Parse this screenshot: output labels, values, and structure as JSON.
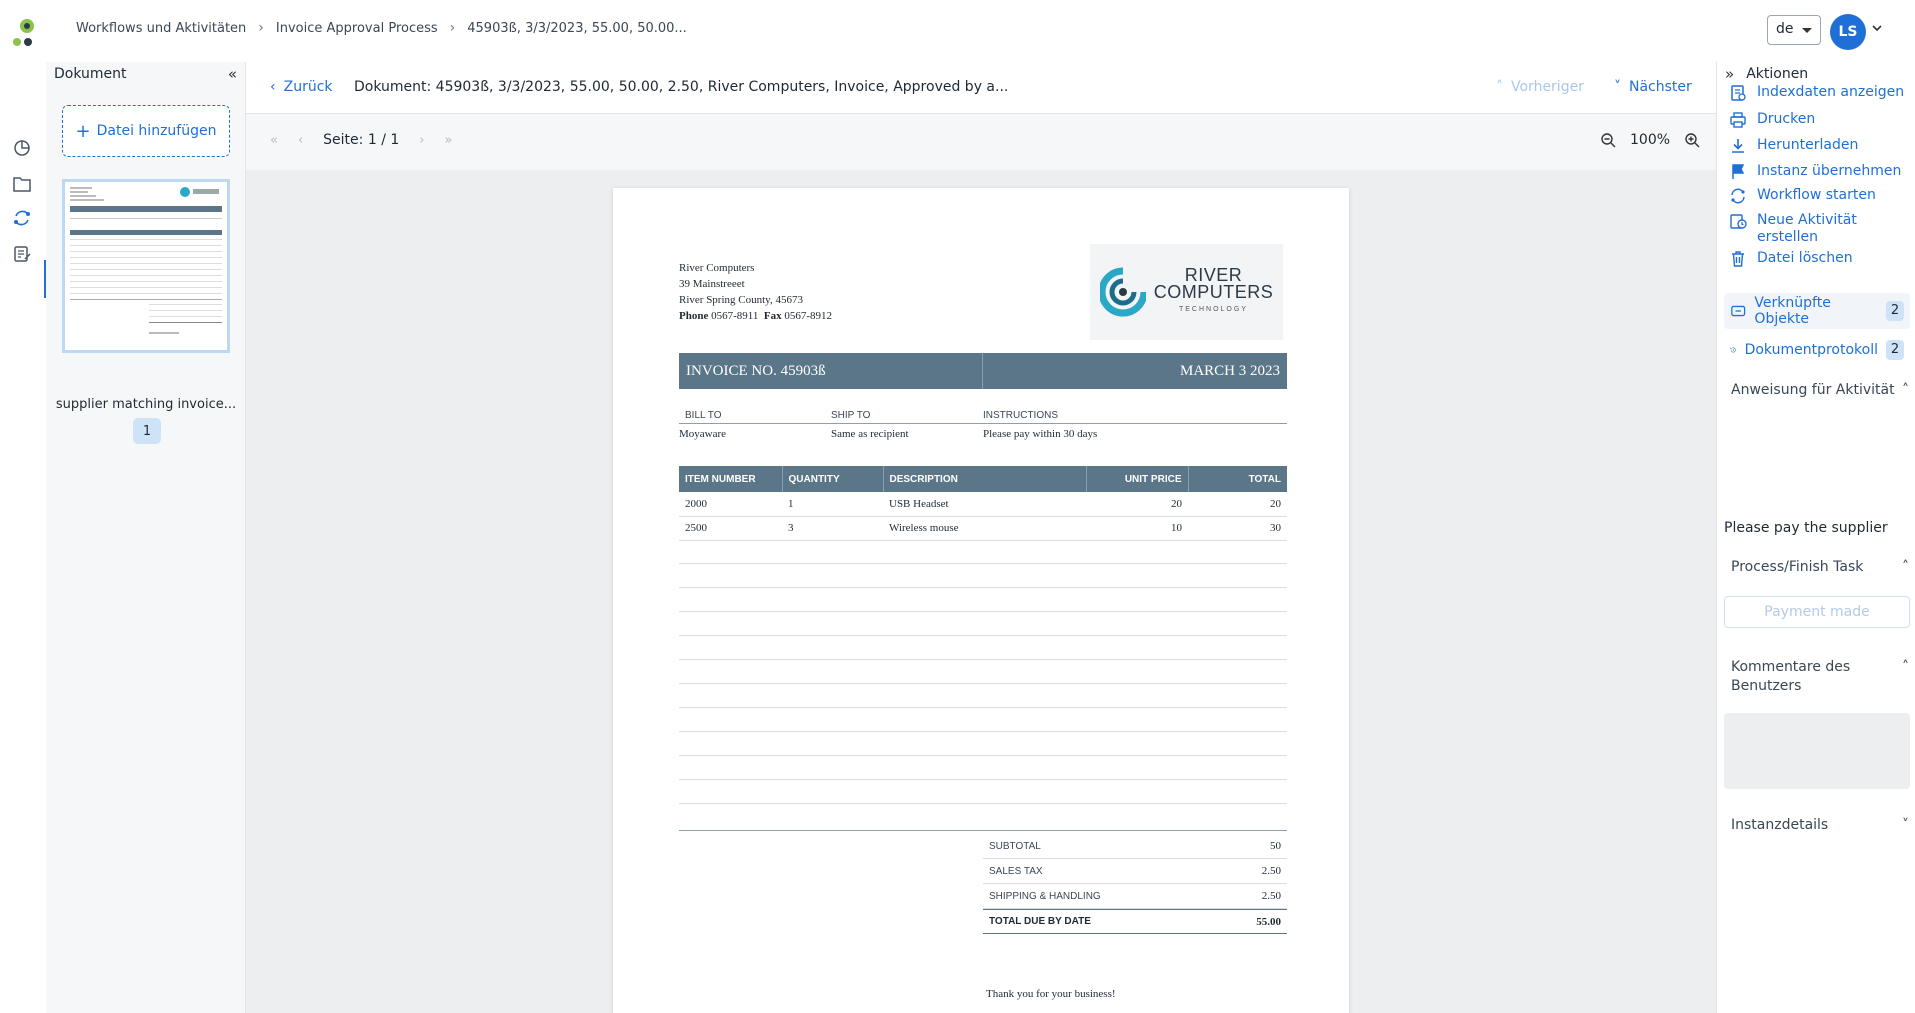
{
  "breadcrumb": [
    "Workflows und Aktivitäten",
    "Invoice Approval Process",
    "45903ß, 3/3/2023, 55.00, 50.00..."
  ],
  "lang": "de",
  "user_initials": "LS",
  "doc_panel": {
    "title": "Dokument",
    "add_file": "Datei hinzufügen",
    "file_label": "supplier matching invoice...",
    "page_badge": "1"
  },
  "viewer": {
    "back": "Zurück",
    "title": "Dokument: 45903ß, 3/3/2023, 55.00, 50.00, 2.50, River Computers, Invoice, Approved by a...",
    "prev": "Vorheriger",
    "next": "Nächster",
    "page_info": "Seite: 1 / 1",
    "zoom": "100%"
  },
  "invoice": {
    "company": "River Computers",
    "street": "39 Mainstreeet",
    "city": "River Spring County, 45673",
    "phone_label": "Phone",
    "phone": "0567-8911",
    "fax_label": "Fax",
    "fax": "0567-8912",
    "brand_line1": "RIVER",
    "brand_line2": "COMPUTERS",
    "brand_line3": "TECHNOLOGY",
    "number": "INVOICE NO. 45903ß",
    "date": "MARCH 3 2023",
    "bill_to_label": "BILL TO",
    "ship_to_label": "SHIP TO",
    "instructions_label": "INSTRUCTIONS",
    "bill_to": "Moyaware",
    "ship_to": "Same as recipient",
    "instructions": "Please pay within 30 days",
    "columns": [
      "ITEM NUMBER",
      "QUANTITY",
      "DESCRIPTION",
      "UNIT PRICE",
      "TOTAL"
    ],
    "rows": [
      [
        "2000",
        "1",
        "USB Headset",
        "20",
        "20"
      ],
      [
        "2500",
        "3",
        "Wireless mouse",
        "10",
        "30"
      ]
    ],
    "subtotal_label": "SUBTOTAL",
    "subtotal": "50",
    "tax_label": "SALES TAX",
    "tax": "2.50",
    "shipping_label": "SHIPPING & HANDLING",
    "shipping": "2.50",
    "total_label": "TOTAL DUE BY DATE",
    "total": "55.00",
    "thanks": "Thank you for your business!"
  },
  "actions": {
    "title": "Aktionen",
    "items": [
      "Indexdaten anzeigen",
      "Drucken",
      "Herunterladen",
      "Instanz übernehmen",
      "Workflow starten",
      "Neue Aktivität erstellen",
      "Datei löschen"
    ],
    "linked_objects": "Verknüpfte Objekte",
    "linked_count": "2",
    "protocol": "Dokumentprotokoll",
    "protocol_count": "2",
    "instruction_title": "Anweisung für Aktivität",
    "instruction_text": "Please pay the supplier",
    "process_title": "Process/Finish Task",
    "payment_button": "Payment made",
    "comments_title": "Kommentare des Benutzers",
    "instance_details": "Instanzdetails"
  },
  "colors": {
    "accent": "#1f6fd6",
    "invoice_header": "#5b7589",
    "logo_green": "#8bc34a",
    "logo_dark": "#2b3a47"
  }
}
